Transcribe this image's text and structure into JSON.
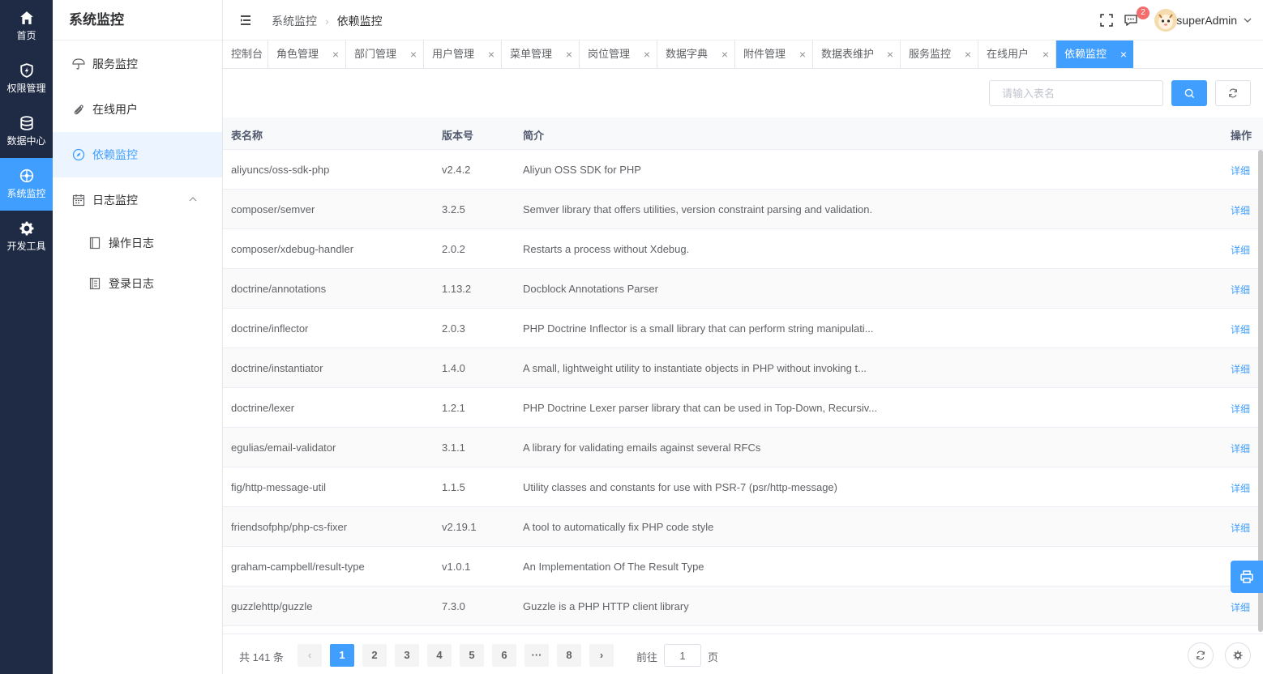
{
  "rail": [
    {
      "label": "首页",
      "icon": "home-icon"
    },
    {
      "label": "权限管理",
      "icon": "shield-icon"
    },
    {
      "label": "数据中心",
      "icon": "database-icon"
    },
    {
      "label": "系统监控",
      "icon": "monitor-icon",
      "active": true
    },
    {
      "label": "开发工具",
      "icon": "gear-icon"
    }
  ],
  "submenu": {
    "title": "系统监控",
    "items": [
      {
        "label": "服务监控",
        "icon": "umbrella-icon"
      },
      {
        "label": "在线用户",
        "icon": "paperclip-icon"
      },
      {
        "label": "依赖监控",
        "icon": "compass-icon",
        "active": true
      },
      {
        "label": "日志监控",
        "icon": "calendar-icon",
        "expanded": true
      },
      {
        "label": "操作日志",
        "icon": "notebook-icon"
      },
      {
        "label": "登录日志",
        "icon": "document-icon"
      }
    ]
  },
  "header": {
    "breadcrumb": [
      "系统监控",
      "依赖监控"
    ],
    "badge": "2",
    "username": "superAdmin"
  },
  "tabs": [
    "控制台",
    "角色管理",
    "部门管理",
    "用户管理",
    "菜单管理",
    "岗位管理",
    "数据字典",
    "附件管理",
    "数据表维护",
    "服务监控",
    "在线用户",
    "依赖监控"
  ],
  "search": {
    "placeholder": "请输入表名",
    "value": ""
  },
  "table": {
    "headers": [
      "表名称",
      "版本号",
      "简介",
      "操作"
    ],
    "action_label": "详细",
    "rows": [
      [
        "aliyuncs/oss-sdk-php",
        "v2.4.2",
        "Aliyun OSS SDK for PHP"
      ],
      [
        "composer/semver",
        "3.2.5",
        "Semver library that offers utilities, version constraint parsing and validation."
      ],
      [
        "composer/xdebug-handler",
        "2.0.2",
        "Restarts a process without Xdebug."
      ],
      [
        "doctrine/annotations",
        "1.13.2",
        "Docblock Annotations Parser"
      ],
      [
        "doctrine/inflector",
        "2.0.3",
        "PHP Doctrine Inflector is a small library that can perform string manipulati..."
      ],
      [
        "doctrine/instantiator",
        "1.4.0",
        "A small, lightweight utility to instantiate objects in PHP without invoking t..."
      ],
      [
        "doctrine/lexer",
        "1.2.1",
        "PHP Doctrine Lexer parser library that can be used in Top-Down, Recursiv..."
      ],
      [
        "egulias/email-validator",
        "3.1.1",
        "A library for validating emails against several RFCs"
      ],
      [
        "fig/http-message-util",
        "1.1.5",
        "Utility classes and constants for use with PSR-7 (psr/http-message)"
      ],
      [
        "friendsofphp/php-cs-fixer",
        "v2.19.1",
        "A tool to automatically fix PHP code style"
      ],
      [
        "graham-campbell/result-type",
        "v1.0.1",
        "An Implementation Of The Result Type"
      ],
      [
        "guzzlehttp/guzzle",
        "7.3.0",
        "Guzzle is a PHP HTTP client library"
      ]
    ]
  },
  "pagination": {
    "total": "共 141 条",
    "pages": [
      "1",
      "2",
      "3",
      "4",
      "5",
      "6",
      "···",
      "8"
    ],
    "current": "1",
    "goto_label": "前往",
    "goto_value": "1",
    "goto_suffix": "页"
  },
  "colors": {
    "accent": "#409eff",
    "rail": "#1f2a44",
    "badge": "#f56c6c"
  }
}
